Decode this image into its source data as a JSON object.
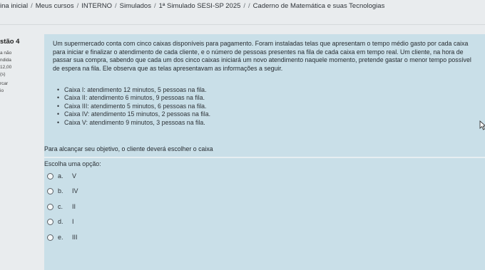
{
  "breadcrumb": [
    "ina inicial",
    "Meus cursos",
    "INTERNO",
    "Simulados",
    "1ª Simulado SESI-SP 2025",
    "",
    "Caderno de Matemática e suas Tecnologias"
  ],
  "info": {
    "question_label": "stão 4",
    "status1": "a não",
    "status2": "ndida",
    "grade": "12,00",
    "suffix": "(s)",
    "flag1": "rcar",
    "flag2": "io"
  },
  "statement": "Um supermercado conta com cinco caixas disponíveis para pagamento. Foram instaladas telas que apresentam o tempo médio gasto por cada caixa para iniciar e finalizar o atendimento de cada cliente, e o número de pessoas presentes na fila de cada caixa em tempo real. Um cliente, na hora de passar sua compra, sabendo que cada um dos cinco caixas iniciará um novo atendimento naquele momento, pretende gastar o menor tempo possível de espera na fila. Ele observa que as telas apresentavam as informações a seguir.",
  "items": [
    "Caixa I: atendimento 12 minutos, 5 pessoas na fila.",
    "Caixa II: atendimento 6 minutos, 9 pessoas na fila.",
    "Caixa III: atendimento 5 minutos, 6 pessoas na fila.",
    "Caixa IV: atendimento 15 minutos, 2 pessoas na fila.",
    "Caixa V: atendimento 9 minutos, 3 pessoas na fila."
  ],
  "question": "Para alcançar seu objetivo, o cliente deverá escolher o caixa",
  "prompt": "Escolha uma opção:",
  "options": [
    {
      "letter": "a.",
      "value": "V"
    },
    {
      "letter": "b.",
      "value": "IV"
    },
    {
      "letter": "c.",
      "value": "II"
    },
    {
      "letter": "d.",
      "value": "I"
    },
    {
      "letter": "e.",
      "value": "III"
    }
  ],
  "icons": {
    "cursor": "mouse-pointer-icon"
  }
}
